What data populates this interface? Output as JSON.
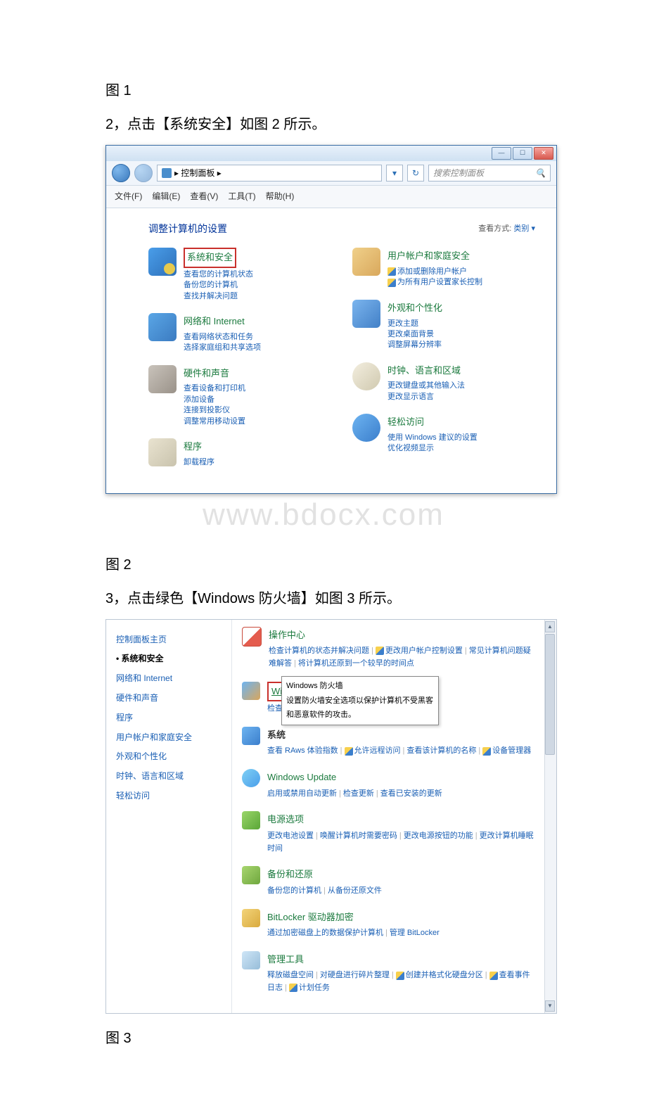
{
  "text": {
    "fig1": "图 1",
    "step2": "2，点击【系统安全】如图 2 所示。",
    "fig2": "图 2",
    "step3": "3，点击绿色【Windows 防火墙】如图 3 所示。",
    "fig3": "图 3",
    "watermark": "www.bdocx.com"
  },
  "win1": {
    "breadcrumb": "▸ 控制面板 ▸",
    "dropdown": "▾",
    "search_placeholder": "搜索控制面板",
    "search_icon": "🔍",
    "menu": [
      "文件(F)",
      "编辑(E)",
      "查看(V)",
      "工具(T)",
      "帮助(H)"
    ],
    "heading": "调整计算机的设置",
    "viewby_label": "查看方式:",
    "viewby_value": "类别 ▾",
    "left_categories": [
      {
        "title": "系统和安全",
        "boxed": true,
        "iconClass": "sys",
        "links": [
          "查看您的计算机状态",
          "备份您的计算机",
          "查找并解决问题"
        ]
      },
      {
        "title": "网络和 Internet",
        "iconClass": "net",
        "links": [
          "查看网络状态和任务",
          "选择家庭组和共享选项"
        ]
      },
      {
        "title": "硬件和声音",
        "iconClass": "hw",
        "links": [
          "查看设备和打印机",
          "添加设备",
          "连接到投影仪",
          "调整常用移动设置"
        ]
      },
      {
        "title": "程序",
        "iconClass": "prog",
        "links": [
          "卸载程序"
        ]
      }
    ],
    "right_categories": [
      {
        "title": "用户帐户和家庭安全",
        "iconClass": "user",
        "links": [
          {
            "shield": true,
            "text": "添加或删除用户帐户"
          },
          {
            "shield": true,
            "text": "为所有用户设置家长控制"
          }
        ]
      },
      {
        "title": "外观和个性化",
        "iconClass": "appr",
        "links": [
          "更改主题",
          "更改桌面背景",
          "调整屏幕分辨率"
        ]
      },
      {
        "title": "时钟、语言和区域",
        "iconClass": "clock",
        "links": [
          "更改键盘或其他输入法",
          "更改显示语言"
        ]
      },
      {
        "title": "轻松访问",
        "iconClass": "ease",
        "links": [
          "使用 Windows 建议的设置",
          "优化视频显示"
        ]
      }
    ]
  },
  "win2": {
    "side_home": "控制面板主页",
    "side_items": [
      "系统和安全",
      "网络和 Internet",
      "硬件和声音",
      "程序",
      "用户帐户和家庭安全",
      "外观和个性化",
      "时钟、语言和区域",
      "轻松访问"
    ],
    "sections": [
      {
        "icon": "flag",
        "title": "操作中心",
        "links": [
          {
            "text": "检查计算机的状态并解决问题"
          },
          {
            "shield": true,
            "text": "更改用户帐户控制设置"
          },
          {
            "text": "常见计算机问题疑难解答"
          },
          {
            "text": "将计算机还原到一个较早的时间点"
          }
        ]
      },
      {
        "icon": "fw",
        "title": "Windows 防火墙",
        "boxed": true,
        "links": [
          {
            "text": "检查防火"
          },
          {
            "text": "防火墙",
            "trailing": true
          }
        ]
      },
      {
        "icon": "pc",
        "title": "系统",
        "black": true,
        "links": [
          {
            "text": "查看 RA"
          },
          {
            "text": "ws 体验指数",
            "trailing": true
          },
          {
            "shield": true,
            "text": "允许远程访问"
          },
          {
            "text": "查看该计算机的名称"
          },
          {
            "shield": true,
            "text": "设备管理器"
          }
        ]
      },
      {
        "icon": "wu",
        "title": "Windows Update",
        "links": [
          {
            "text": "启用或禁用自动更新"
          },
          {
            "text": "检查更新"
          },
          {
            "text": "查看已安装的更新"
          }
        ]
      },
      {
        "icon": "pwr",
        "title": "电源选项",
        "links": [
          {
            "text": "更改电池设置"
          },
          {
            "text": "唤醒计算机时需要密码"
          },
          {
            "text": "更改电源按钮的功能"
          },
          {
            "text": "更改计算机睡眠时间"
          }
        ]
      },
      {
        "icon": "bkp",
        "title": "备份和还原",
        "links": [
          {
            "text": "备份您的计算机"
          },
          {
            "text": "从备份还原文件"
          }
        ]
      },
      {
        "icon": "bit",
        "title": "BitLocker 驱动器加密",
        "links": [
          {
            "text": "通过加密磁盘上的数据保护计算机"
          },
          {
            "text": "管理 BitLocker"
          }
        ]
      },
      {
        "icon": "adm",
        "title": "管理工具",
        "links": [
          {
            "text": "释放磁盘空间"
          },
          {
            "text": "对硬盘进行碎片整理"
          },
          {
            "shield": true,
            "text": "创建并格式化硬盘分区"
          },
          {
            "shield": true,
            "text": "查看事件日志"
          },
          {
            "shield": true,
            "text": "计划任务"
          }
        ]
      }
    ],
    "tooltip": {
      "title": "Windows 防火墙",
      "line": "设置防火墙安全选项以保护计算机不受黑客和恶意软件的攻击。"
    }
  }
}
